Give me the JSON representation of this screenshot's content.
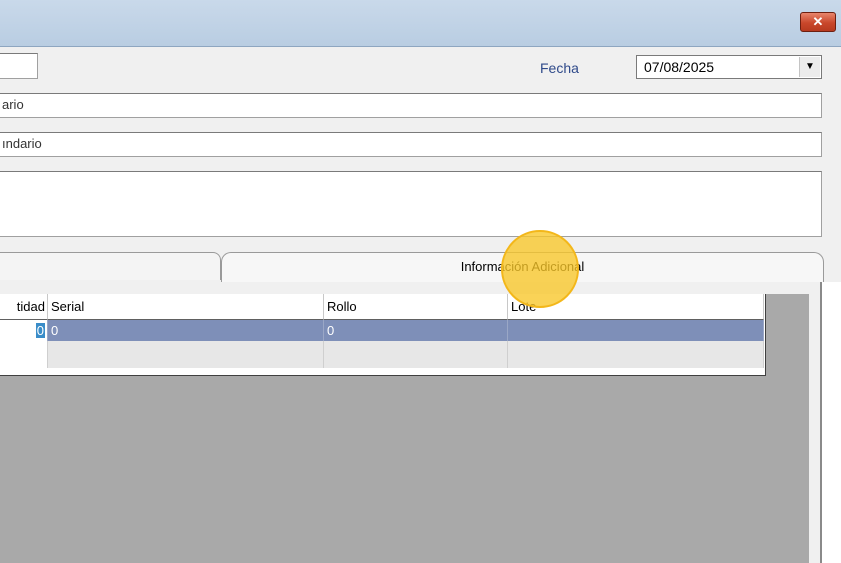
{
  "window": {
    "close_glyph": "✕"
  },
  "form": {
    "field_top_value": "",
    "fecha_label": "Fecha",
    "fecha_value": "07/08/2025",
    "fecha_dropdown_glyph": "▼",
    "field_1_text": "ario",
    "field_2_text": "ındario",
    "field_3_text": ""
  },
  "tabs": {
    "left_label": "",
    "right_label": "Información Adicional"
  },
  "grid": {
    "columns": [
      "tidad",
      "Serial",
      "Rollo",
      "Lote"
    ],
    "rows": [
      {
        "cantidad": "0",
        "serial": "0",
        "rollo": "0",
        "lote": ""
      },
      {
        "cantidad": "",
        "serial": "",
        "rollo": "",
        "lote": ""
      }
    ]
  },
  "colors": {
    "titlebar": "#c2d4e8",
    "close_button": "#c9472b",
    "selected_row": "#7e8fb8",
    "grid_empty_area": "#a9a9a9",
    "click_highlight": "#f9c628"
  }
}
